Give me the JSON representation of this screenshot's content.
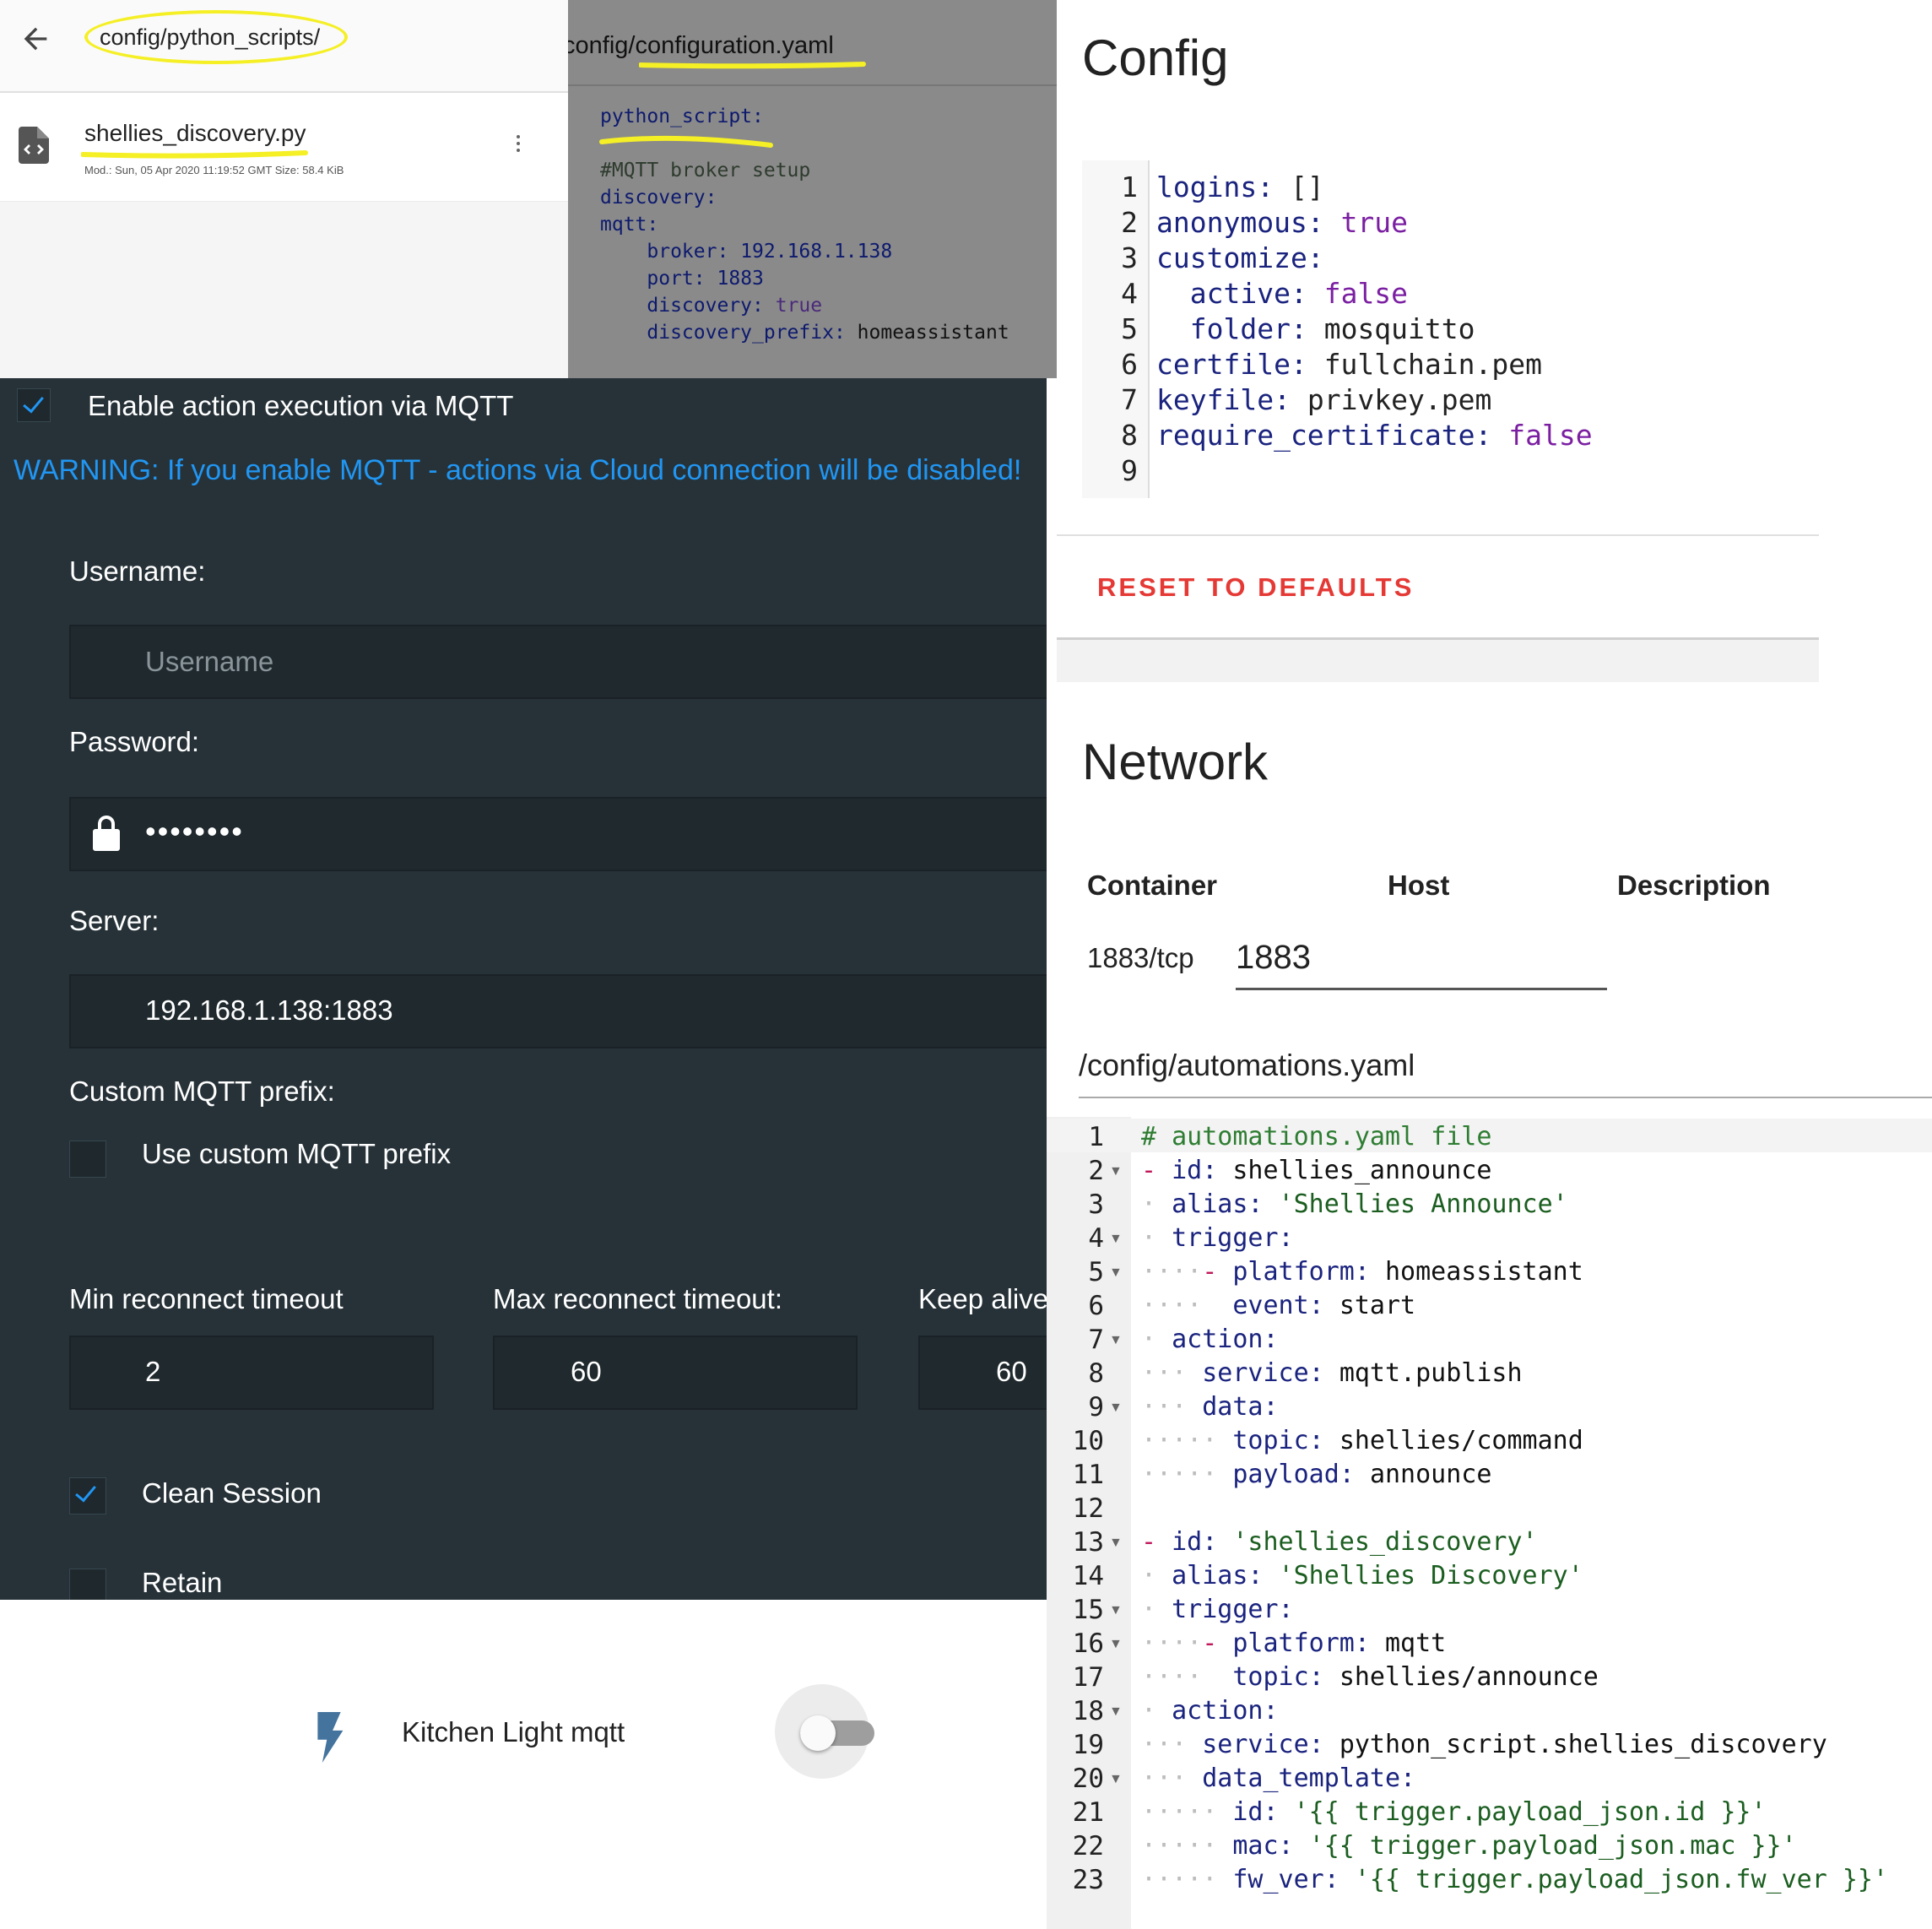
{
  "file_browser": {
    "path": "config/python_scripts/",
    "file": {
      "name": "shellies_discovery.py",
      "meta": "Mod.: Sun, 05 Apr 2020 11:19:52 GMT  Size: 58.4 KiB"
    },
    "highlight_color": "#f5ef25"
  },
  "configuration_yaml": {
    "title": "config/configuration.yaml",
    "lines": [
      "python_script:",
      "",
      "#MQTT broker setup",
      "discovery:",
      "mqtt:",
      "broker:",
      "192.168.1.138",
      "port:",
      "1883",
      "discovery:",
      "true",
      "discovery_prefix:",
      "homeassistant"
    ]
  },
  "mqtt_settings": {
    "enable_label": "Enable action execution via MQTT",
    "enable_checked": true,
    "warning": "WARNING: If you enable MQTT - actions via Cloud connection will be disabled!",
    "username_label": "Username:",
    "username_placeholder": "Username",
    "password_label": "Password:",
    "password_mask": "••••••••",
    "server_label": "Server:",
    "server_value": "192.168.1.138:1883",
    "prefix_label": "Custom MQTT prefix:",
    "use_prefix_label": "Use custom MQTT prefix",
    "use_prefix_checked": false,
    "min_reconnect_label": "Min reconnect timeout",
    "min_reconnect_value": "2",
    "max_reconnect_label": "Max reconnect timeout:",
    "max_reconnect_value": "60",
    "keep_alive_label": "Keep alive",
    "keep_alive_value": "60",
    "clean_session_label": "Clean Session",
    "clean_session_checked": true,
    "retain_label": "Retain",
    "accent_color": "#2196f3"
  },
  "toggle_card": {
    "name": "Kitchen Light mqtt",
    "icon": "flash-icon",
    "state_on": false
  },
  "config_card": {
    "title": "Config",
    "line_numbers": [
      "1",
      "2",
      "3",
      "4",
      "5",
      "6",
      "7",
      "8",
      "9"
    ],
    "yaml": {
      "l1_key": "logins:",
      "l1_val": "[]",
      "l2_key": "anonymous:",
      "l2_val": "true",
      "l3_key": "customize:",
      "l4_key": "active:",
      "l4_val": "false",
      "l5_key": "folder:",
      "l5_val": "mosquitto",
      "l6_key": "certfile:",
      "l6_val": "fullchain.pem",
      "l7_key": "keyfile:",
      "l7_val": "privkey.pem",
      "l8_key": "require_certificate:",
      "l8_val": "false"
    },
    "reset_label": "RESET TO DEFAULTS",
    "reset_color": "#e53935"
  },
  "network_card": {
    "title": "Network",
    "columns": [
      "Container",
      "Host",
      "Description"
    ],
    "rows": [
      {
        "container": "1883/tcp",
        "host": "1883"
      }
    ]
  },
  "automations_yaml": {
    "title": "/config/automations.yaml",
    "line_numbers": [
      "1",
      "2",
      "3",
      "4",
      "5",
      "6",
      "7",
      "8",
      "9",
      "10",
      "11",
      "12",
      "13",
      "14",
      "15",
      "16",
      "17",
      "18",
      "19",
      "20",
      "21",
      "22",
      "23"
    ],
    "l1": "# automations.yaml file",
    "l2_key": "id:",
    "l2_val": "shellies_announce",
    "l3_key": "alias:",
    "l3_val": "'Shellies Announce'",
    "l4_key": "trigger:",
    "l5_key": "platform:",
    "l5_val": "homeassistant",
    "l6_key": "event:",
    "l6_val": "start",
    "l7_key": "action:",
    "l8_key": "service:",
    "l8_val": "mqtt.publish",
    "l9_key": "data:",
    "l10_key": "topic:",
    "l10_val": "shellies/command",
    "l11_key": "payload:",
    "l11_val": "announce",
    "l13_key": "id:",
    "l13_val": "'shellies_discovery'",
    "l14_key": "alias:",
    "l14_val": "'Shellies Discovery'",
    "l15_key": "trigger:",
    "l16_key": "platform:",
    "l16_val": "mqtt",
    "l17_key": "topic:",
    "l17_val": "shellies/announce",
    "l18_key": "action:",
    "l19_key": "service:",
    "l19_val": "python_script.shellies_discovery",
    "l20_key": "data_template:",
    "l21_key": "id:",
    "l21_val": "'{{ trigger.payload_json.id }}'",
    "l22_key": "mac:",
    "l22_val": "'{{ trigger.payload_json.mac }}'",
    "l23_key": "fw_ver:",
    "l23_val": "'{{ trigger.payload_json.fw_ver }}'"
  }
}
